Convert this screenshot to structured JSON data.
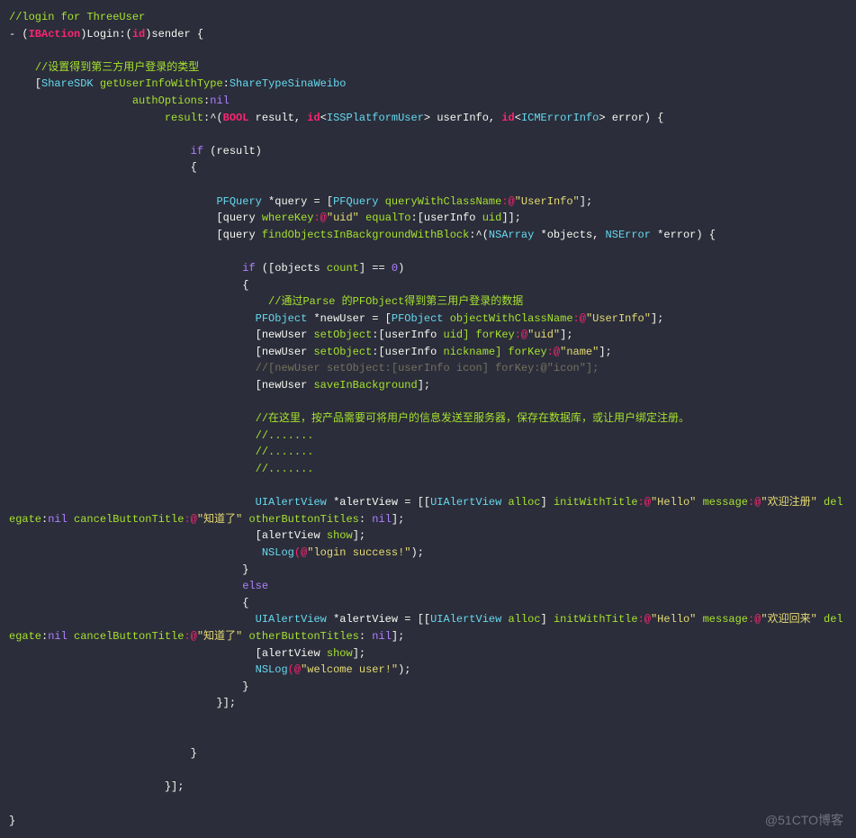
{
  "watermark": "@51CTO博客",
  "code": {
    "ln1_comment": "//login for ThreeUser",
    "ln2_dash": "- (",
    "ln2_ibaction": "IBAction",
    "ln2_login": ")Login:(",
    "ln2_id": "id",
    "ln2_sender": ")sender {",
    "ln4_comment": "//设置得到第三方用户登录的类型",
    "ln5_open": "[",
    "ln5_sharesdk": "ShareSDK",
    "ln5_getuser": " getUserInfoWithType",
    "ln5_colon1": ":",
    "ln5_sharetype": "ShareTypeSinaWeibo",
    "ln6_authopt": "authOptions",
    "ln6_nil": "nil",
    "ln7_result": "result",
    "ln7_caret": ":^(",
    "ln7_bool": "BOOL",
    "ln7_resultvar": " result, ",
    "ln7_id1": "id",
    "ln7_issp": "ISSPlatformUser",
    "ln7_userinfo": "> userInfo, ",
    "ln7_id2": "id",
    "ln7_icm": "ICMErrorInfo",
    "ln7_error": "> error) {",
    "ln9_if": "if",
    "ln9_paren": " (result)",
    "ln10_brace": "{",
    "ln12_pfquery": "PFQuery",
    "ln12_star": " *query = [",
    "ln12_pfquery2": "PFQuery",
    "ln12_querywith": " queryWithClassName",
    "ln12_at": ":@",
    "ln12_userinfo_str": "\"UserInfo\"",
    "ln12_close": "];",
    "ln13_open": "[query ",
    "ln13_wherekey": "whereKey",
    "ln13_at": ":@",
    "ln13_uid": "\"uid\"",
    "ln13_equalto": " equalTo",
    "ln13_colon": ":[userInfo ",
    "ln13_uid2": "uid",
    "ln13_close": "]];",
    "ln14_open": "[query ",
    "ln14_find": "findObjectsInBackgroundWithBlock",
    "ln14_caret": ":^(",
    "ln14_nsarray": "NSArray",
    "ln14_objects": " *objects, ",
    "ln14_nserror": "NSError",
    "ln14_error": " *error) {",
    "ln16_if": "if",
    "ln16_open": " ([objects ",
    "ln16_count": "count",
    "ln16_eq": "] == ",
    "ln16_zero": "0",
    "ln16_close": ")",
    "ln17_brace": "{",
    "ln18_comment": " //通过Parse 的PFObject得到第三用户登录的数据",
    "ln19_pfobject": "PFObject",
    "ln19_star": " *newUser = [",
    "ln19_pfobject2": "PFObject",
    "ln19_objwith": " objectWithClassName",
    "ln19_at": ":@",
    "ln19_userinfo": "\"UserInfo\"",
    "ln19_close": "];",
    "ln20_open": "[newUser ",
    "ln20_setobj": "setObject",
    "ln20_colon": ":[userInfo ",
    "ln20_uid": "uid",
    "ln20_forkey": "] forKey",
    "ln20_at": ":@",
    "ln20_uid_str": "\"uid\"",
    "ln20_close": "];",
    "ln21_open": "[newUser ",
    "ln21_setobj": "setObject",
    "ln21_colon": ":[userInfo ",
    "ln21_nick": "nickname",
    "ln21_forkey": "] forKey",
    "ln21_at": ":@",
    "ln21_name": "\"name\"",
    "ln21_close": "];",
    "ln22_comment": "//[newUser setObject:[userInfo icon] forKey:@\"icon\"];",
    "ln23_open": "[newUser ",
    "ln23_save": "saveInBackground",
    "ln23_close": "];",
    "ln25_comment": "//在这里，按产品需要可将用户的信息发送至服务器，保存在数据库，或让用户绑定注册。",
    "ln26_dots": "//.......",
    "ln27_dots": "//.......",
    "ln28_dots": "//.......",
    "ln30_uialert": "UIAlertView",
    "ln30_star": " *alertView = [[",
    "ln30_uialert2": "UIAlertView",
    "ln30_alloc": " alloc",
    "ln30_close1": "] ",
    "ln30_initwith": "initWithTitle",
    "ln30_at1": ":@",
    "ln30_hello": "\"Hello\"",
    "ln30_message": " message",
    "ln30_at2": ":@",
    "ln30_welcome": "\"欢迎注册\"",
    "ln30_delegate": " delegate",
    "ln30_nil": "nil",
    "ln30_cancel": " cancelButtonTitle",
    "ln30_at3": ":@",
    "ln30_know": "\"知道了\"",
    "ln30_other": " otherButtonTitles",
    "ln30_nil2": "nil",
    "ln30_close2": "];",
    "ln31_open": "[alertView ",
    "ln31_show": "show",
    "ln31_close": "];",
    "ln32_nslog": " NSLog",
    "ln32_open": "(@",
    "ln32_str": "\"login success!\"",
    "ln32_close": ");",
    "ln33_brace": "}",
    "ln34_else": "else",
    "ln35_brace": "{",
    "ln36_uialert": "UIAlertView",
    "ln36_star": " *alertView = [[",
    "ln36_uialert2": "UIAlertView",
    "ln36_alloc": " alloc",
    "ln36_close1": "] ",
    "ln36_initwith": "initWithTitle",
    "ln36_at1": ":@",
    "ln36_hello": "\"Hello\"",
    "ln36_message": " message",
    "ln36_at2": ":@",
    "ln36_welcome": "\"欢迎回来\"",
    "ln36_delegate": " delegate",
    "ln36_nil": "nil",
    "ln36_cancel": " cancelButtonTitle",
    "ln36_at3": ":@",
    "ln36_know": "\"知道了\"",
    "ln36_other": " otherButtonTitles",
    "ln36_nil2": "nil",
    "ln36_close2": "];",
    "ln37_open": "[alertView ",
    "ln37_show": "show",
    "ln37_close": "];",
    "ln38_nslog": "NSLog",
    "ln38_open": "(@",
    "ln38_str": "\"welcome user!\"",
    "ln38_close": ");",
    "ln39_brace": "}",
    "ln40_close": "}];",
    "ln43_brace": "}",
    "ln45_close": "}];",
    "ln47_brace": "}"
  }
}
